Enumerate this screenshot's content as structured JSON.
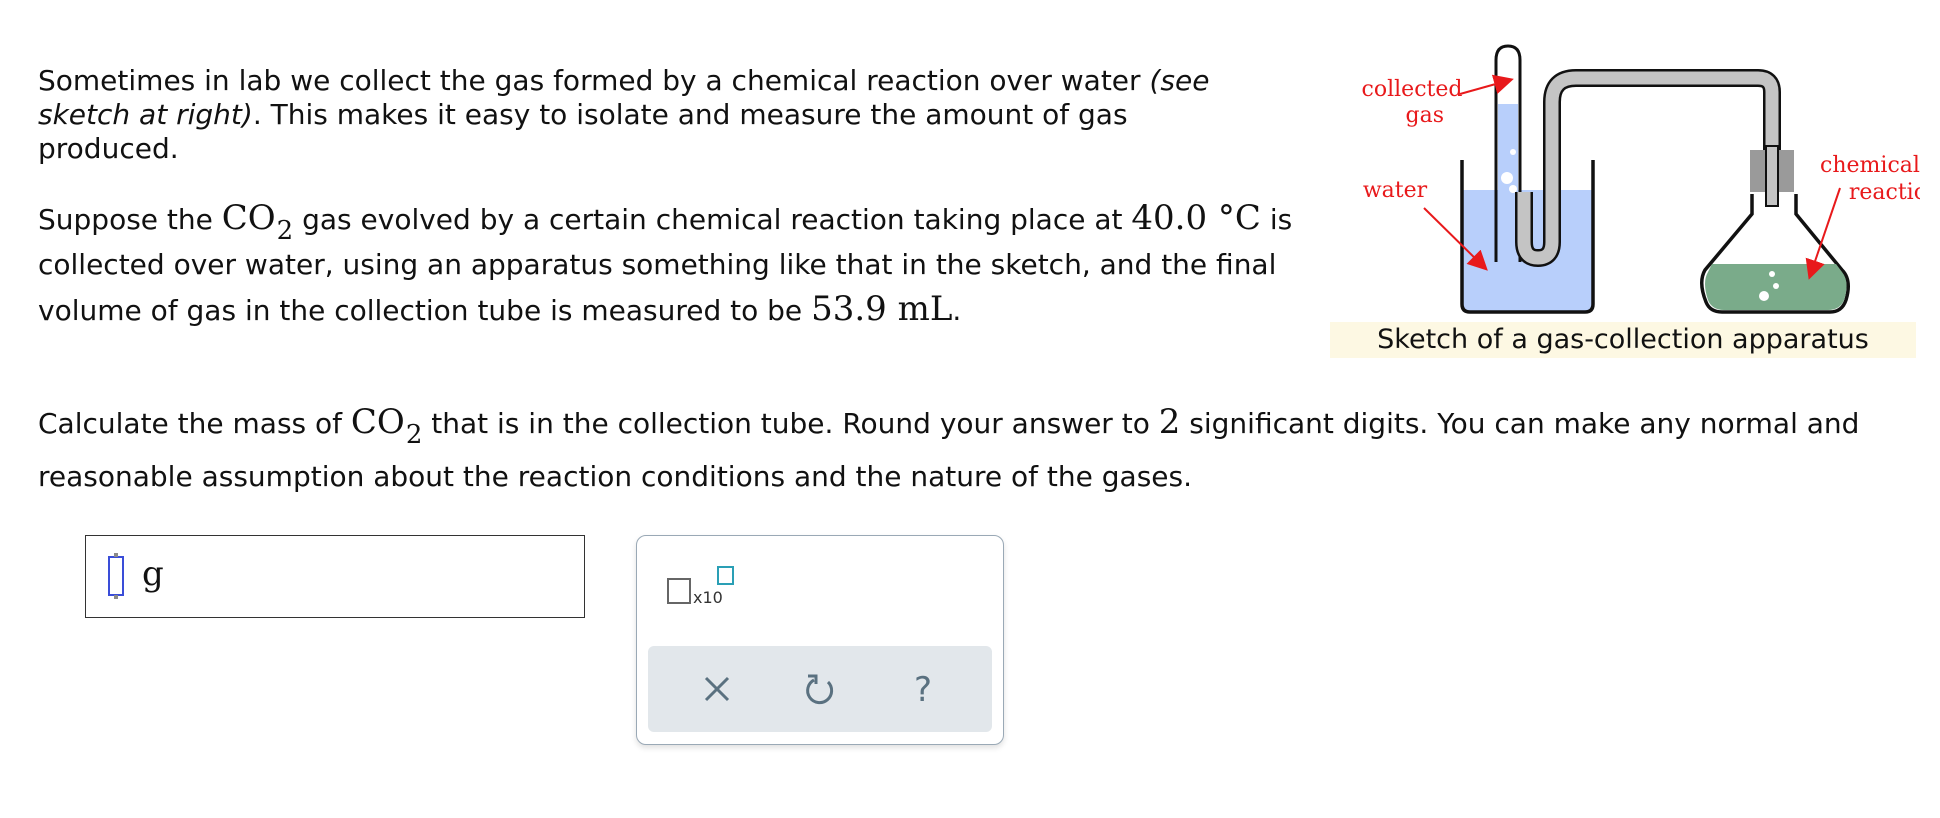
{
  "intro": {
    "text1": "Sometimes in lab we collect the gas formed by a chemical reaction over water ",
    "italic": "(see sketch at right)",
    "text2": ". This makes it easy to isolate and measure the amount of gas produced."
  },
  "setup": {
    "t1": "Suppose the ",
    "gas_formula": "CO",
    "gas_subscript": "2",
    "t2": " gas evolved by a certain chemical reaction taking place at ",
    "temperature": "40.0 °C",
    "t3": " is collected over water, using an apparatus something like that in the sketch, and the final volume of gas in the collection tube is measured to be ",
    "volume": "53.9 mL",
    "t4": "."
  },
  "question": {
    "t1": "Calculate the mass of ",
    "gas_formula": "CO",
    "gas_subscript": "2",
    "t2": " that is in the collection tube. Round your answer to ",
    "sig_digits": "2",
    "t3": " significant digits. You can make any normal and reasonable assumption about the reaction conditions and the nature of the gases."
  },
  "sketch": {
    "label_collected_line1": "collected",
    "label_collected_line2": "gas",
    "label_water": "water",
    "label_chemical_line1": "chemical",
    "label_chemical_line2": "reaction",
    "caption": "Sketch of a gas-collection apparatus",
    "colors": {
      "water": "#b8cffb",
      "reaction_liquid": "#7aab8a",
      "tube": "#c4c4c4",
      "arrow": "#e8191b",
      "caption_bg": "#fdf8e3"
    }
  },
  "answer": {
    "value": "",
    "unit": "g"
  },
  "palette": {
    "sci_notation_label": "x10",
    "sci_icon": "scientific-notation-icon",
    "clear_icon": "x-icon",
    "undo_icon": "undo-icon",
    "help_icon": "question-mark-icon",
    "help_glyph": "?",
    "colors": {
      "icon": "#5a7180",
      "accent": "#2a9fb5",
      "bar_bg": "#e2e7eb"
    }
  }
}
